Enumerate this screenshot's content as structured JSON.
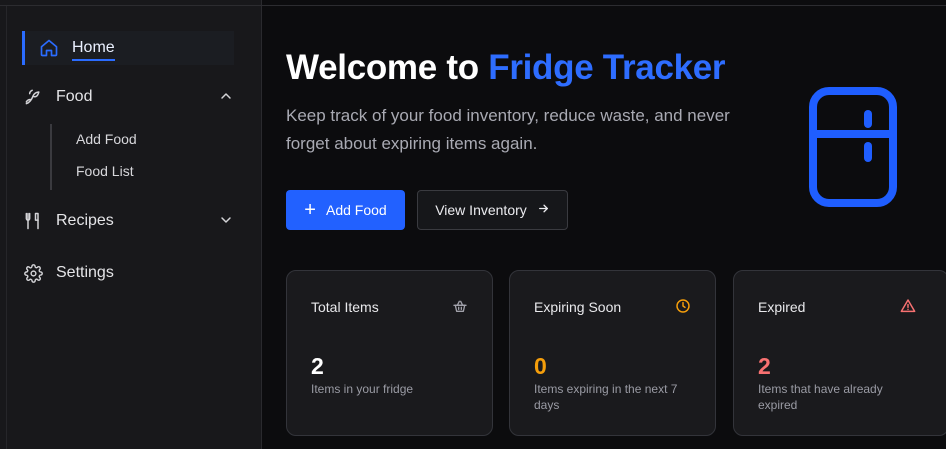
{
  "sidebar": {
    "items": [
      {
        "label": "Home",
        "icon": "home-icon",
        "active": true
      },
      {
        "label": "Food",
        "icon": "food-icon",
        "expanded": true,
        "children": [
          {
            "label": "Add Food"
          },
          {
            "label": "Food List"
          }
        ]
      },
      {
        "label": "Recipes",
        "icon": "fork-knife-icon",
        "expanded": false
      },
      {
        "label": "Settings",
        "icon": "gear-icon"
      }
    ]
  },
  "hero": {
    "title_prefix": "Welcome to",
    "title_accent": "Fridge Tracker",
    "subtitle": "Keep track of your food inventory, reduce waste, and never forget about expiring items again.",
    "primary_button": "Add Food",
    "secondary_button": "View Inventory",
    "illustration": "fridge-icon"
  },
  "stats": [
    {
      "title": "Total Items",
      "value": "2",
      "description": "Items in your fridge",
      "icon": "basket-icon",
      "color": "#ffffff",
      "icon_color": "#a1a1aa"
    },
    {
      "title": "Expiring Soon",
      "value": "0",
      "description": "Items expiring in the next 7 days",
      "icon": "clock-icon",
      "color": "#f59e0b",
      "icon_color": "#f59e0b"
    },
    {
      "title": "Expired",
      "value": "2",
      "description": "Items that have already expired",
      "icon": "alert-triangle-icon",
      "color": "#f87171",
      "icon_color": "#f87171"
    }
  ],
  "colors": {
    "accent": "#2b6cff",
    "background": "#0c0c0e",
    "sidebar": "#18181b"
  }
}
